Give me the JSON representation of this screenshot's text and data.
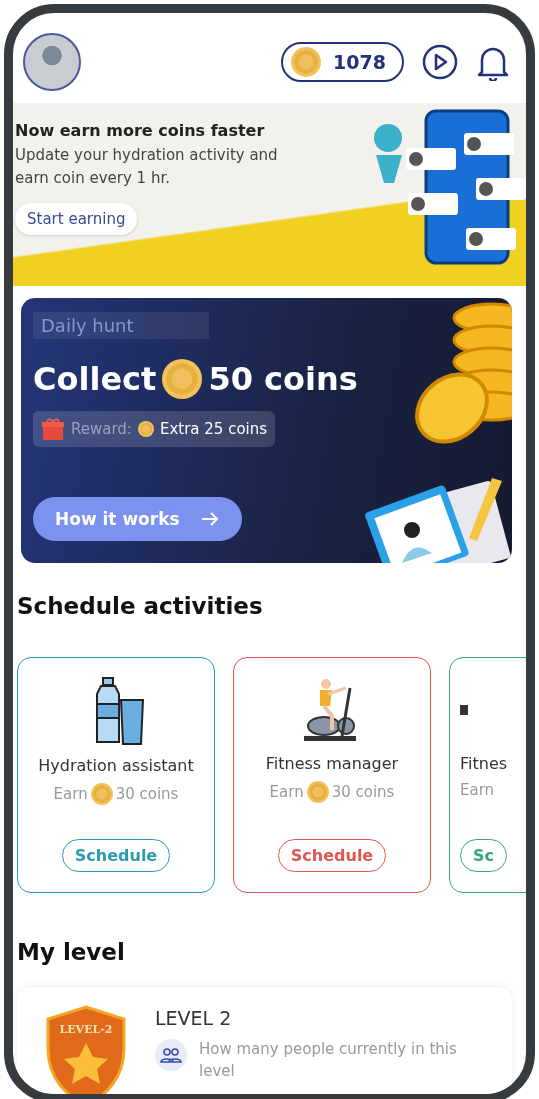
{
  "header": {
    "coin_balance": "1078"
  },
  "promo_banner": {
    "title": "Now earn more coins faster",
    "body": "Update your hydration activity and earn coin every 1 hr.",
    "button": "Start earning"
  },
  "daily_hunt": {
    "tag": "Daily hunt",
    "title_prefix": "Collect",
    "title_suffix": "50 coins",
    "reward_label": "Reward:",
    "reward_value": "Extra 25 coins",
    "button": "How it works"
  },
  "schedule_section": {
    "title": "Schedule activities",
    "cards": [
      {
        "kind": "hydration",
        "title": "Hydration assistant",
        "earn": "Earn",
        "reward": "30 coins",
        "button": "Schedule",
        "color": "#2a9bb0"
      },
      {
        "kind": "cycling",
        "title": "Fitness manager",
        "earn": "Earn",
        "reward": "30 coins",
        "button": "Schedule",
        "color": "#e0574f"
      },
      {
        "kind": "partial",
        "title": "Fitnes",
        "earn": "Earn",
        "button": "Sc",
        "color": "#3aa57a"
      }
    ]
  },
  "level_section": {
    "title": "My level",
    "badge_text": "LEVEL-2",
    "level": "LEVEL 2",
    "description": "How many people currently in this level"
  }
}
